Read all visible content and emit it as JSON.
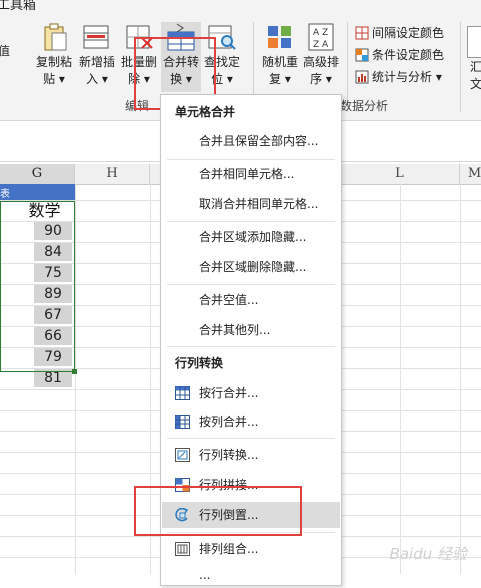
{
  "ribbon": {
    "title_fragment": "工具箱",
    "left_edge_label": "值",
    "buttons": [
      {
        "id": "copy-paste",
        "line1": "复制粘",
        "line2": "贴 ▾"
      },
      {
        "id": "batch-insert",
        "line1": "新增插",
        "line2": "入 ▾"
      },
      {
        "id": "batch-delete",
        "line1": "批量删",
        "line2": "除 ▾"
      },
      {
        "id": "merge-convert",
        "line1": "合并转",
        "line2": "换 ▾"
      },
      {
        "id": "find-locate",
        "line1": "查找定",
        "line2": "位 ▾"
      },
      {
        "id": "random-repeat",
        "line1": "随机重",
        "line2": "复 ▾"
      },
      {
        "id": "advanced-sort",
        "line1": "高级排",
        "line2": "序 ▾"
      }
    ],
    "small_buttons": [
      "间隔设定颜色",
      "条件设定颜色",
      "统计与分析 ▾"
    ],
    "right_edge_label_1": "汇",
    "right_edge_label_2": "文",
    "group_edit": "编辑",
    "group_data": "数据分析"
  },
  "columns": {
    "G": "G",
    "H": "H",
    "L": "L",
    "M": "M"
  },
  "sheet": {
    "header_fragment": "表",
    "column_title": "数学",
    "scores": [
      "90",
      "84",
      "75",
      "89",
      "67",
      "66",
      "79",
      "81"
    ]
  },
  "dropdown": {
    "section1": "单元格合并",
    "items1": [
      "合并且保留全部内容...",
      "合并相同单元格...",
      "取消合并相同单元格...",
      "合并区域添加隐藏...",
      "合并区域删除隐藏...",
      "合并空值...",
      "合并其他列..."
    ],
    "section2": "行列转换",
    "items2": [
      "按行合并...",
      "按列合并...",
      "行列转换...",
      "行列拼接...",
      "行列倒置...",
      "排列组合...",
      "..."
    ]
  },
  "watermark": "Baidu 经验",
  "colors": {
    "header_fill": "#4472c4",
    "selection": "#2e7d32",
    "highlight": "#e0403e",
    "hover": "#dcdcdc"
  }
}
